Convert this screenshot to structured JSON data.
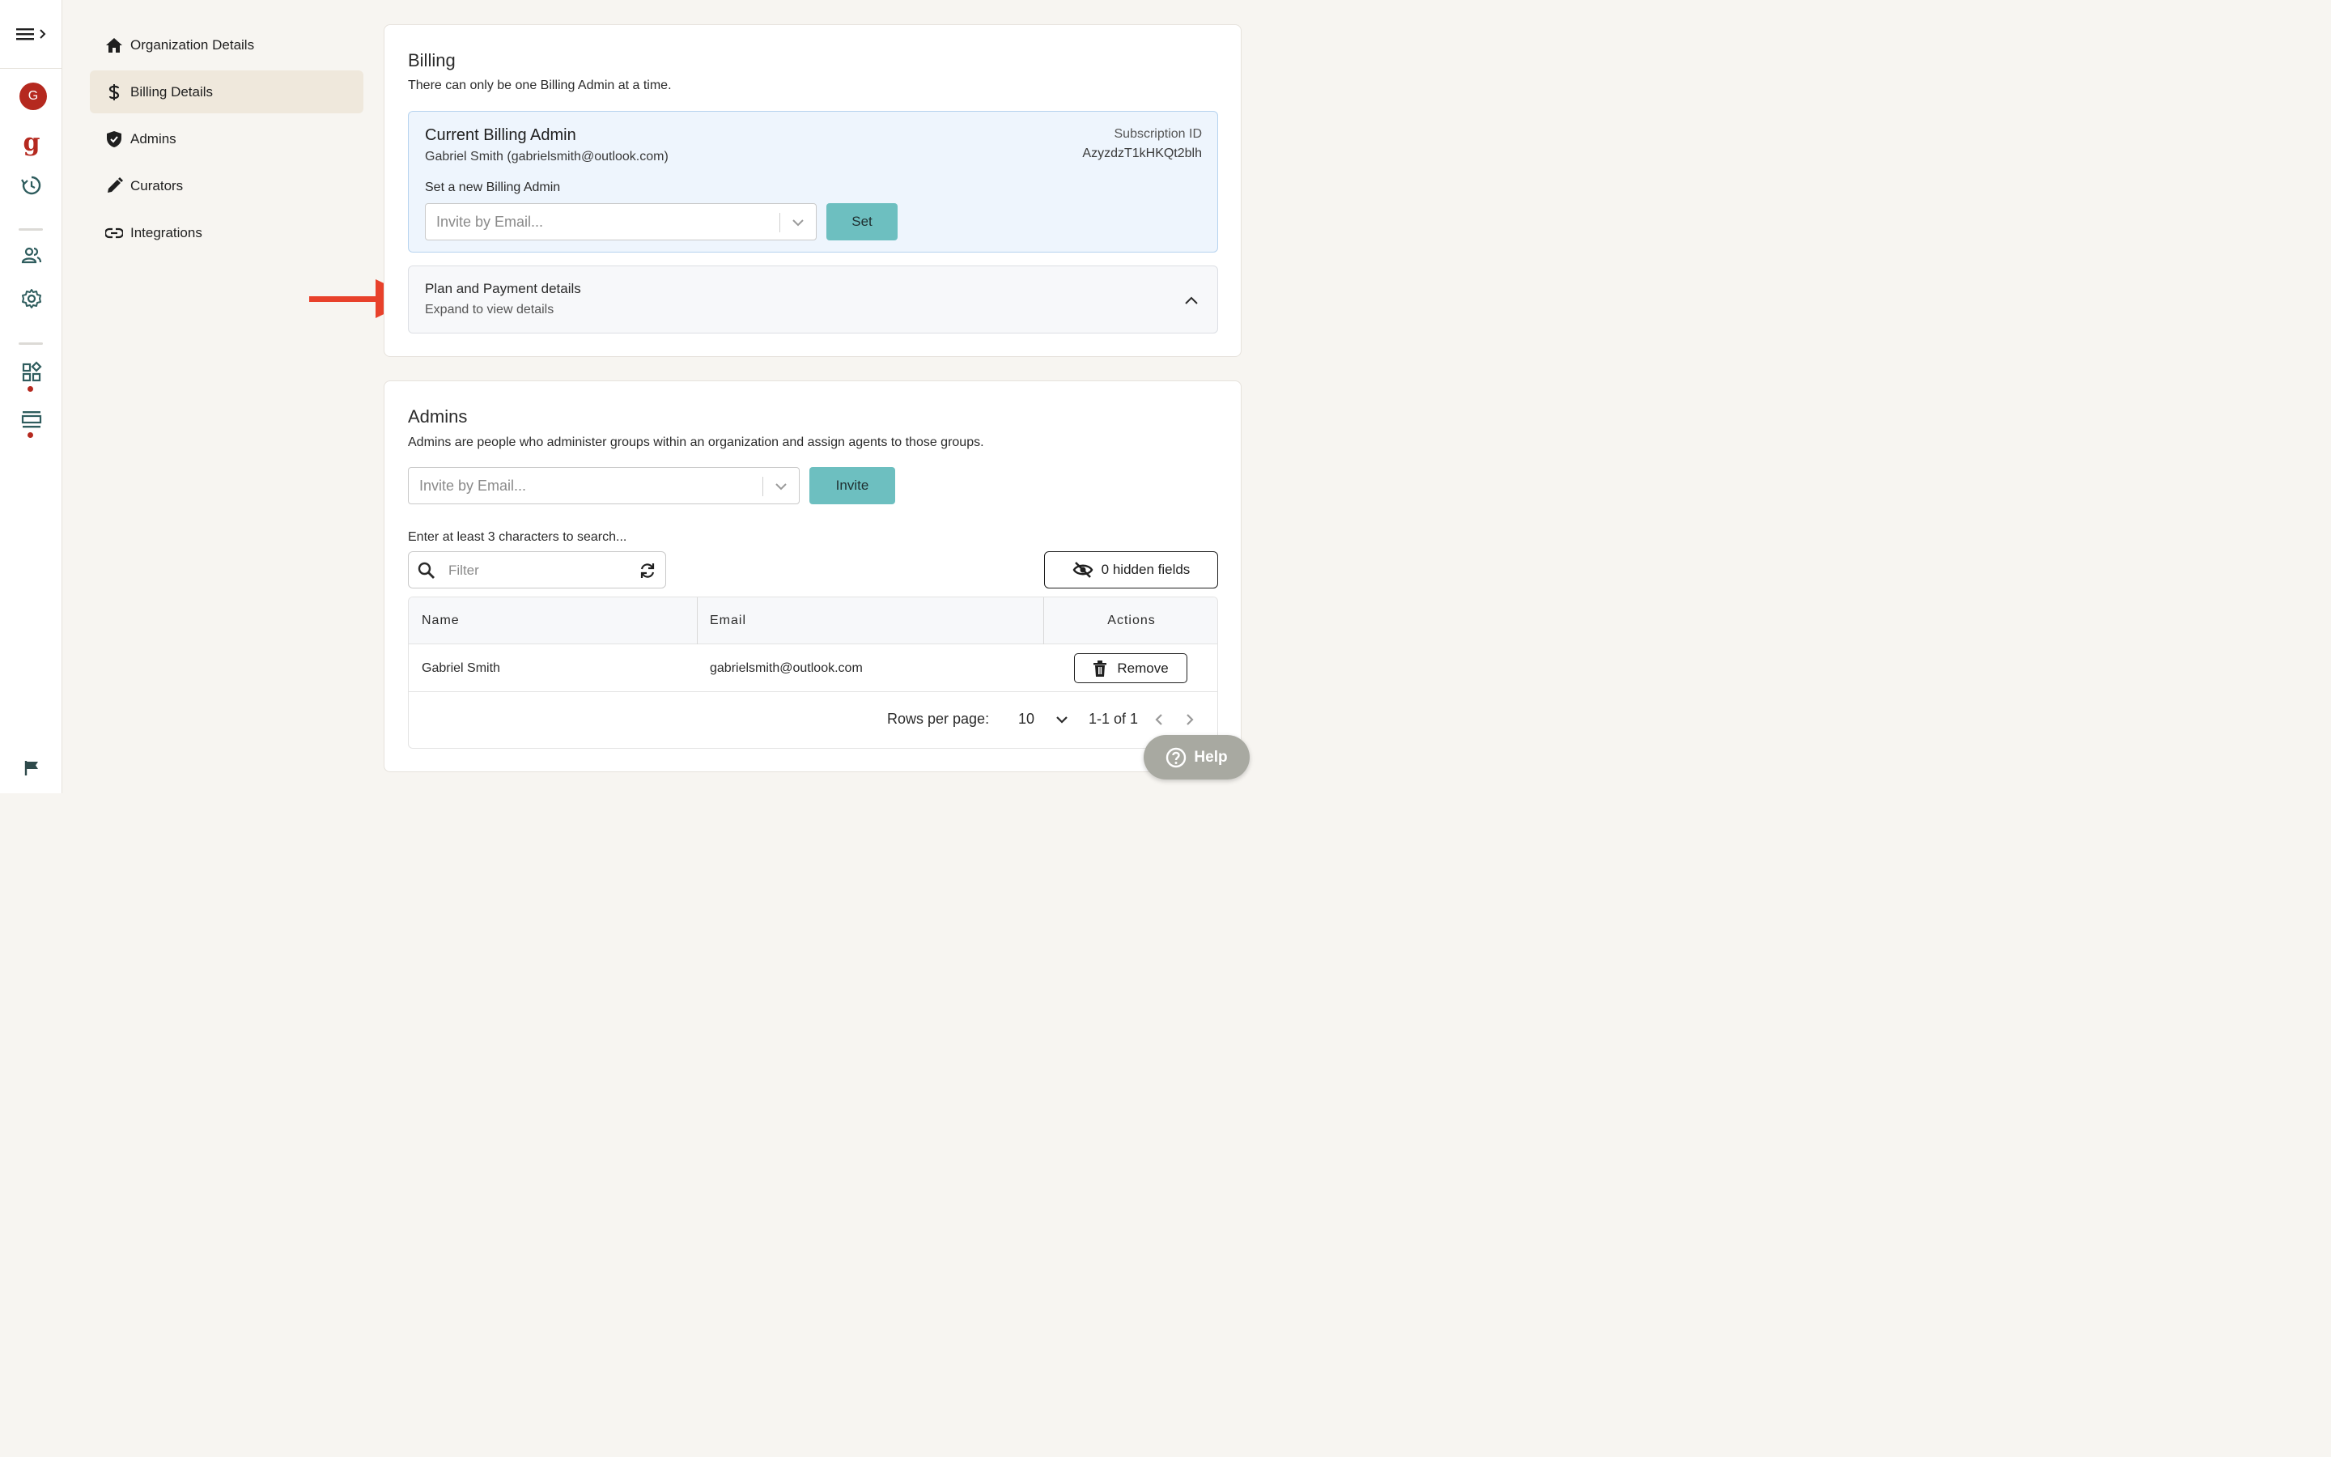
{
  "rail": {
    "avatar_initial": "G",
    "logo_letter": "g",
    "icons": [
      "menu-icon",
      "history-icon",
      "people-icon",
      "gear-icon",
      "widgets-icon",
      "list-view-icon",
      "flag-icon"
    ],
    "accent_color": "#b5291f"
  },
  "nav": {
    "items": [
      {
        "label": "Organization Details",
        "icon": "home-icon"
      },
      {
        "label": "Billing Details",
        "icon": "dollar-icon",
        "active": true
      },
      {
        "label": "Admins",
        "icon": "shield-check-icon"
      },
      {
        "label": "Curators",
        "icon": "pencil-icon"
      },
      {
        "label": "Integrations",
        "icon": "link-icon"
      }
    ]
  },
  "billing": {
    "title": "Billing",
    "subtitle": "There can only be one Billing Admin at a time.",
    "current_admin_title": "Current Billing Admin",
    "current_admin_user": "Gabriel Smith (gabrielsmith@outlook.com)",
    "subscription_label": "Subscription ID",
    "subscription_id": "AzyzdzT1kHKQt2blh",
    "new_admin_label": "Set a new Billing Admin",
    "invite_placeholder": "Invite by Email...",
    "set_label": "Set",
    "plan_title": "Plan and Payment details",
    "plan_subtitle": "Expand to view details"
  },
  "admins": {
    "title": "Admins",
    "subtitle": "Admins are people who administer groups within an organization and assign agents to those groups.",
    "invite_placeholder": "Invite by Email...",
    "invite_label": "Invite",
    "search_hint": "Enter at least 3 characters to search...",
    "filter_placeholder": "Filter",
    "hidden_fields_label": "0 hidden fields",
    "table": {
      "columns": [
        "Name",
        "Email",
        "Actions"
      ],
      "rows": [
        {
          "name": "Gabriel Smith",
          "email": "gabrielsmith@outlook.com",
          "action": "Remove"
        }
      ]
    },
    "pager": {
      "rows_per_page_label": "Rows per page:",
      "rows_per_page": "10",
      "range": "1-1 of 1"
    }
  },
  "help": {
    "label": "Help"
  },
  "colors": {
    "teal_button": "#6dbfc0",
    "billing_box_bg": "#eef5fd",
    "arrow": "#e8412b",
    "nav_active_bg": "#efe8dc"
  }
}
